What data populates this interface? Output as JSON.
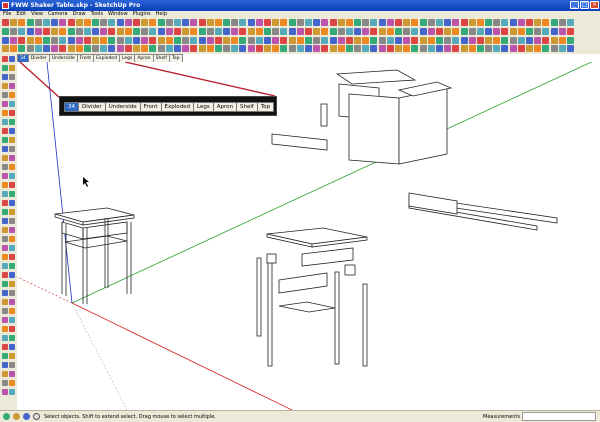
{
  "window": {
    "title": "FWW Shaker Table.skp - SketchUp Pro"
  },
  "menu": {
    "items": [
      "File",
      "Edit",
      "View",
      "Camera",
      "Draw",
      "Tools",
      "Window",
      "Plugins",
      "Help"
    ]
  },
  "scene_tabs": [
    "34",
    "Divider",
    "Underside",
    "Front",
    "Exploded",
    "Legs",
    "Apron",
    "Shelf",
    "Top"
  ],
  "active_scene": "34",
  "zoom_callout": {
    "tabs": [
      "34",
      "Divider",
      "Underside",
      "Front",
      "Exploded",
      "Legs",
      "Apron",
      "Shelf",
      "Top"
    ]
  },
  "status": {
    "text": "Select objects. Shift to extend select. Drag mouse to select multiple.",
    "measurements_label": "Measurements",
    "measurements_value": ""
  },
  "toolbar_colors": [
    "#d44",
    "#3a7",
    "#46c",
    "#c93",
    "#888",
    "#b5a",
    "#e82",
    "#5ab"
  ],
  "axis_colors": {
    "red": "#d62020",
    "green": "#2aa02a",
    "blue": "#2030c8"
  }
}
